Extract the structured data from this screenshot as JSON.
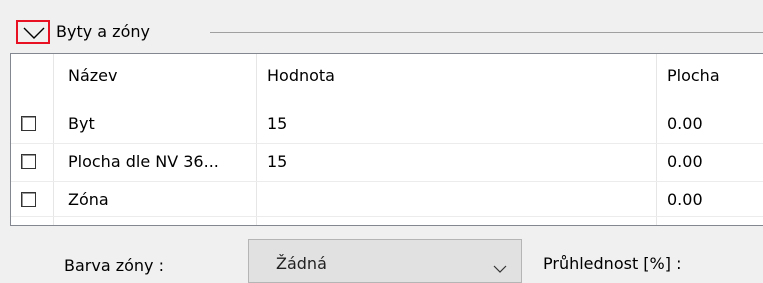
{
  "group": {
    "title": "Byty a zóny"
  },
  "table": {
    "columns": [
      "Název",
      "Hodnota",
      "Plocha"
    ],
    "rows": [
      {
        "nazev": "Byt",
        "hodnota": "15",
        "plocha": "0.00",
        "checked": false
      },
      {
        "nazev": "Plocha dle NV 36...",
        "hodnota": "15",
        "plocha": "0.00",
        "checked": false
      },
      {
        "nazev": "Zóna",
        "hodnota": "",
        "plocha": "0.00",
        "checked": false
      }
    ]
  },
  "bottom": {
    "barva_label": "Barva zóny :",
    "barva_value": "Žádná",
    "pruhlednost_label": "Průhlednost [%] :"
  }
}
